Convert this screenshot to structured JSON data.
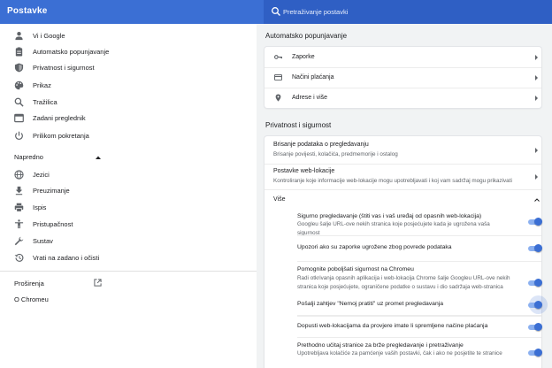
{
  "app": {
    "title": "Postavke"
  },
  "search": {
    "placeholder": "Pretraživanje postavki"
  },
  "sidebar": {
    "items": [
      {
        "label": "Vi i Google",
        "icon": "person-icon"
      },
      {
        "label": "Automatsko popunjavanje",
        "icon": "clipboard-icon"
      },
      {
        "label": "Privatnost i sigurnost",
        "icon": "shield-icon"
      },
      {
        "label": "Prikaz",
        "icon": "palette-icon"
      },
      {
        "label": "Tražilica",
        "icon": "search-icon"
      },
      {
        "label": "Zadani preglednik",
        "icon": "browser-icon"
      },
      {
        "label": "Prilikom pokretanja",
        "icon": "power-icon"
      }
    ],
    "advanced_label": "Napredno",
    "advanced_items": [
      {
        "label": "Jezici",
        "icon": "globe-icon"
      },
      {
        "label": "Preuzimanje",
        "icon": "download-icon"
      },
      {
        "label": "Ispis",
        "icon": "printer-icon"
      },
      {
        "label": "Pristupačnost",
        "icon": "accessibility-icon"
      },
      {
        "label": "Sustav",
        "icon": "wrench-icon"
      },
      {
        "label": "Vrati na zadano i očisti",
        "icon": "history-icon"
      }
    ],
    "extensions_label": "Proširenja",
    "about_label": "O Chromeu"
  },
  "autofill": {
    "title": "Automatsko popunjavanje",
    "rows": [
      {
        "label": "Zaporke",
        "icon": "key-icon"
      },
      {
        "label": "Načini plaćanja",
        "icon": "credit-card-icon"
      },
      {
        "label": "Adrese i više",
        "icon": "location-pin-icon"
      }
    ]
  },
  "privacy": {
    "title": "Privatnost i sigurnost",
    "clear": {
      "title": "Brisanje podataka o pregledavanju",
      "sub": "Brisanje povijesti, kolačića, predmemorije i ostalog"
    },
    "site_settings": {
      "title": "Postavke web-lokacije",
      "sub": "Kontroliranje koje informacije web-lokacije mogu upotrebljavati i koj vam sadržaj mogu prikazivati"
    },
    "more_label": "Više",
    "options": [
      {
        "title": "Sigurno pregledavanje (štiti vas i vaš uređaj od opasnih web-lokacija)",
        "sub": "Googleu šalje URL-ove nekih stranica koje posjećujete kada je ugrožena vaša sigurnost",
        "enabled": true
      },
      {
        "title": "Upozori ako su zaporke ugrožene zbog povrede podataka",
        "sub": "",
        "enabled": true
      },
      {
        "title": "Pomognite poboljšati sigurnost na Chromeu",
        "sub": "Radi otkrivanja opasnih aplikacija i web-lokacija Chrome šalje Googleu URL-ove nekih stranica koje posjećujete, ograničene podatke o sustavu i dio sadržaja web-stranica",
        "enabled": true
      },
      {
        "title": "Pošalji zahtjev \"Nemoj pratiti\" uz promet pregledavanja",
        "sub": "",
        "enabled": true
      },
      {
        "title": "Dopusti web-lokacijama da provjere imate li spremljene načine plaćanja",
        "sub": "",
        "enabled": true
      },
      {
        "title": "Prethodno učitaj stranice za brže pregledavanje i pretraživanje",
        "sub": "Upotrebljava kolačiće za pamćenje vaših postavki, čak i ako ne posjetite te stranice",
        "enabled": true
      }
    ]
  },
  "colors": {
    "header": "#3b6fd4",
    "accent": "#3b6fd4"
  }
}
